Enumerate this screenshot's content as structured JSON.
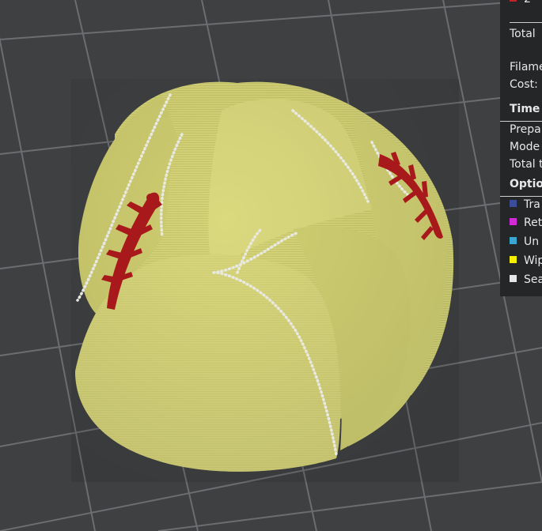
{
  "panel": {
    "extruder_label": "2",
    "extruder_color": "#c0242a",
    "total_label": "Total",
    "filament_label": "Filame",
    "cost_label": "Cost:",
    "time_section": {
      "title": "Time",
      "rows": [
        "Prepa",
        "Mode",
        "Total t"
      ]
    },
    "options_section": {
      "title": "Optio",
      "items": [
        {
          "label": "Tra",
          "color": "#3b4d9a"
        },
        {
          "label": "Ret",
          "color": "#d22ad6"
        },
        {
          "label": "Un",
          "color": "#3aa6d2"
        },
        {
          "label": "Wip",
          "color": "#f5f000"
        },
        {
          "label": "Sea",
          "color": "#e6e6e6"
        }
      ]
    }
  },
  "colors": {
    "background": "#3e4042",
    "grid": "#6b6d70",
    "model": "#d8d77a",
    "model_shadow": "#b4b35a",
    "seam": "#e9e9e3",
    "stitch": "#a8191c"
  }
}
